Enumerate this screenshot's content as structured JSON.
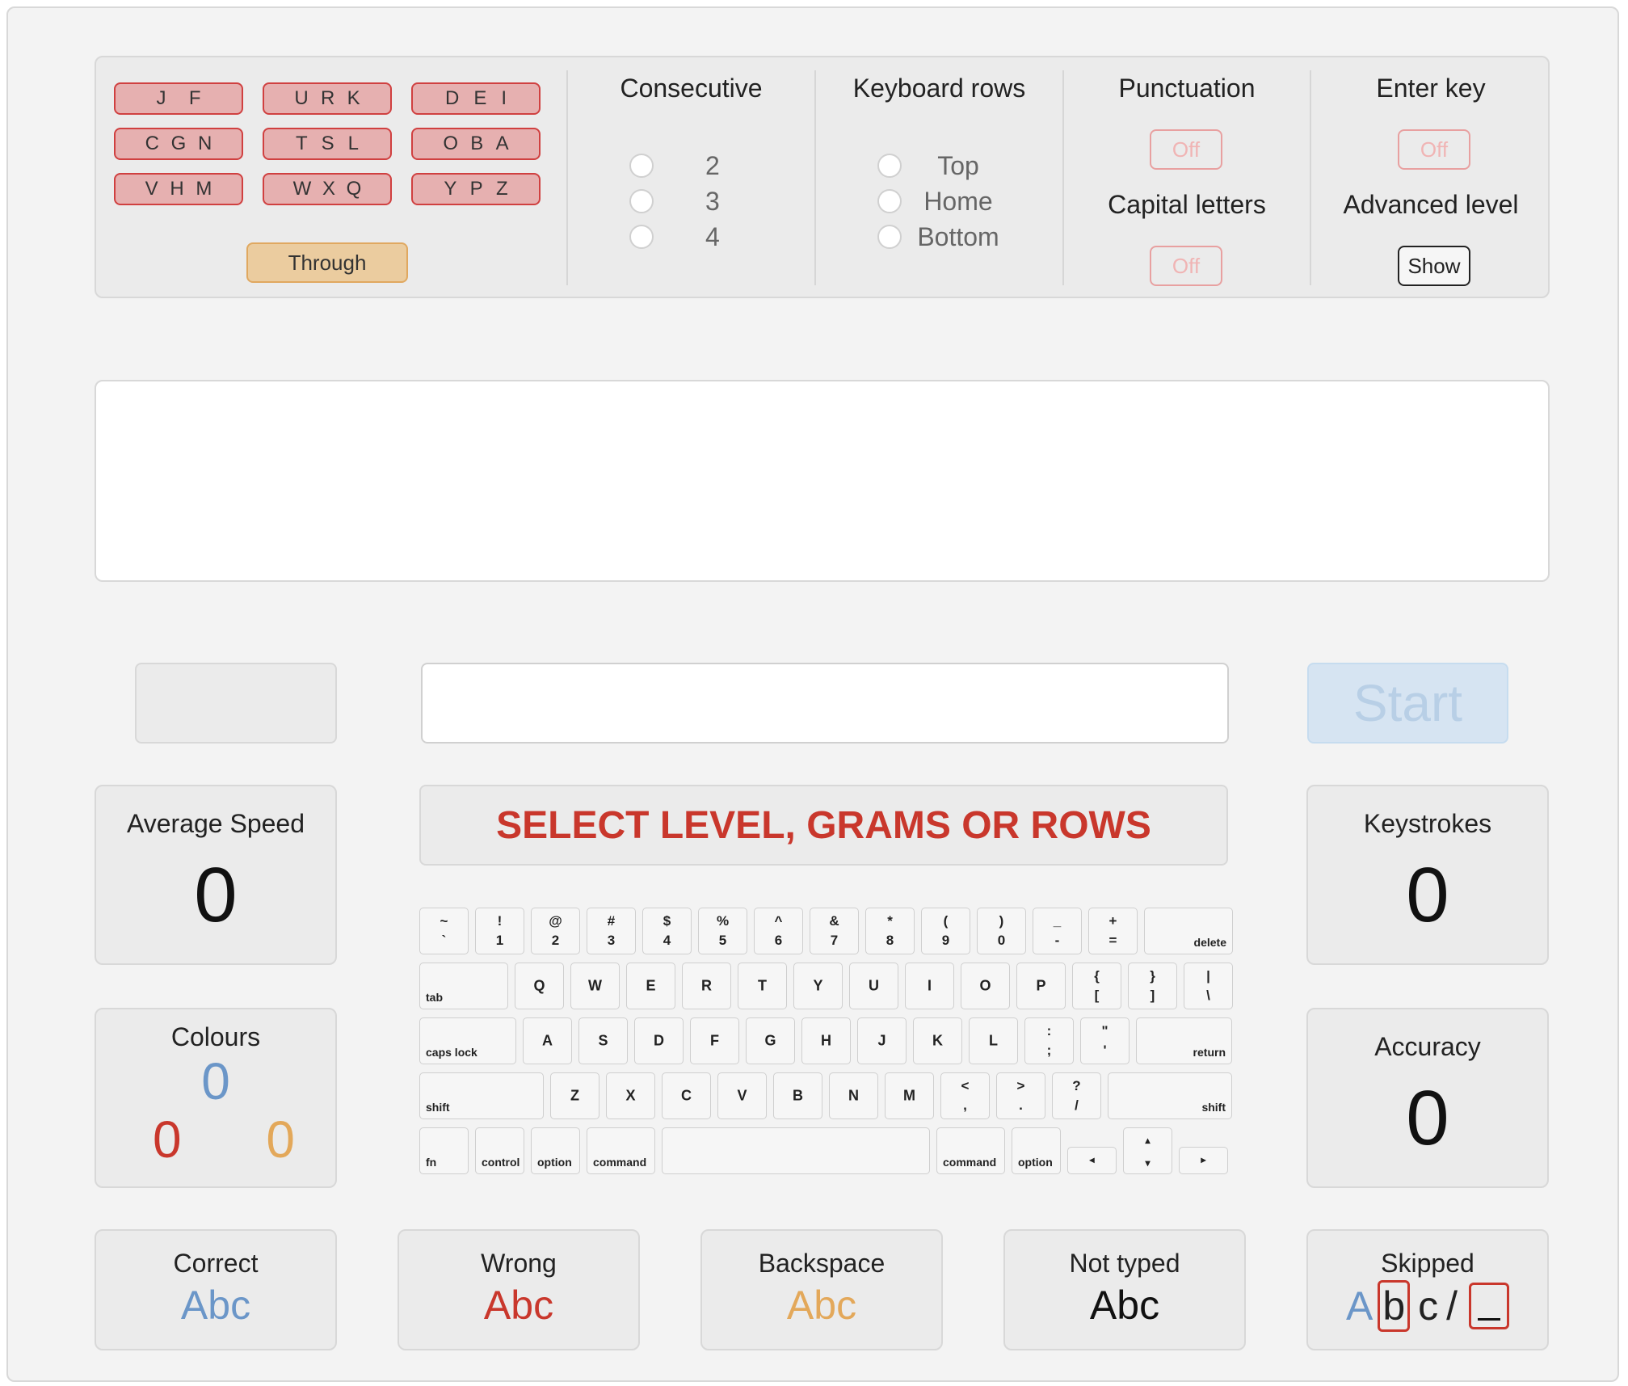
{
  "grams": [
    [
      "J",
      "F"
    ],
    [
      "U",
      "R",
      "K"
    ],
    [
      "D",
      "E",
      "I"
    ],
    [
      "C",
      "G",
      "N"
    ],
    [
      "T",
      "S",
      "L"
    ],
    [
      "O",
      "B",
      "A"
    ],
    [
      "V",
      "H",
      "M"
    ],
    [
      "W",
      "X",
      "Q"
    ],
    [
      "Y",
      "P",
      "Z"
    ]
  ],
  "through_label": "Through",
  "consecutive": {
    "title": "Consecutive",
    "options": [
      "2",
      "3",
      "4"
    ]
  },
  "keyboard_rows": {
    "title": "Keyboard rows",
    "options": [
      "Top",
      "Home",
      "Bottom"
    ]
  },
  "punctuation": {
    "title": "Punctuation",
    "value": "Off"
  },
  "capital_letters": {
    "title": "Capital letters",
    "value": "Off"
  },
  "enter_key": {
    "title": "Enter key",
    "value": "Off"
  },
  "advanced_level": {
    "title": "Advanced level",
    "button": "Show"
  },
  "text_display": "",
  "type_input": {
    "value": "",
    "placeholder": ""
  },
  "start_label": "Start",
  "banner": "SELECT LEVEL, GRAMS OR ROWS",
  "average_speed": {
    "title": "Average Speed",
    "value": "0"
  },
  "keystrokes": {
    "title": "Keystrokes",
    "value": "0"
  },
  "colours": {
    "title": "Colours",
    "blue": "0",
    "red": "0",
    "orange": "0"
  },
  "accuracy": {
    "title": "Accuracy",
    "value": "0"
  },
  "legend": {
    "correct": {
      "title": "Correct",
      "sample": "Abc"
    },
    "wrong": {
      "title": "Wrong",
      "sample": "Abc"
    },
    "backspace": {
      "title": "Backspace",
      "sample": "Abc"
    },
    "not_typed": {
      "title": "Not typed",
      "sample": "Abc"
    },
    "skipped": {
      "title": "Skipped",
      "a": "A",
      "b": "b",
      "c": "c",
      "slash": "/"
    }
  },
  "colors": {
    "blue": "#6b96c8",
    "red": "#c9372c",
    "orange": "#e3a85a"
  },
  "keyboard": {
    "row1": [
      {
        "t": "~",
        "b": "`"
      },
      {
        "t": "!",
        "b": "1"
      },
      {
        "t": "@",
        "b": "2"
      },
      {
        "t": "#",
        "b": "3"
      },
      {
        "t": "$",
        "b": "4"
      },
      {
        "t": "%",
        "b": "5"
      },
      {
        "t": "^",
        "b": "6"
      },
      {
        "t": "&",
        "b": "7"
      },
      {
        "t": "*",
        "b": "8"
      },
      {
        "t": "(",
        "b": "9"
      },
      {
        "t": ")",
        "b": "0"
      },
      {
        "t": "_",
        "b": "-"
      },
      {
        "t": "+",
        "b": "="
      }
    ],
    "delete": "delete",
    "tab": "tab",
    "row2": [
      "Q",
      "W",
      "E",
      "R",
      "T",
      "Y",
      "U",
      "I",
      "O",
      "P"
    ],
    "row2_sym": [
      {
        "t": "{",
        "b": "["
      },
      {
        "t": "}",
        "b": "]"
      },
      {
        "t": "|",
        "b": "\\"
      }
    ],
    "caps_lock": "caps lock",
    "row3": [
      "A",
      "S",
      "D",
      "F",
      "G",
      "H",
      "J",
      "K",
      "L"
    ],
    "row3_sym": [
      {
        "t": ":",
        "b": ";"
      },
      {
        "t": "\"",
        "b": "'"
      }
    ],
    "return": "return",
    "shift": "shift",
    "row4": [
      "Z",
      "X",
      "C",
      "V",
      "B",
      "N",
      "M"
    ],
    "row4_sym": [
      {
        "t": "<",
        "b": ","
      },
      {
        "t": ">",
        "b": "."
      },
      {
        "t": "?",
        "b": "/"
      }
    ],
    "fn": "fn",
    "control": "control",
    "option": "option",
    "command": "command",
    "arrow_left": "◂",
    "arrow_up": "▴",
    "arrow_down": "▾",
    "arrow_right": "▸"
  }
}
